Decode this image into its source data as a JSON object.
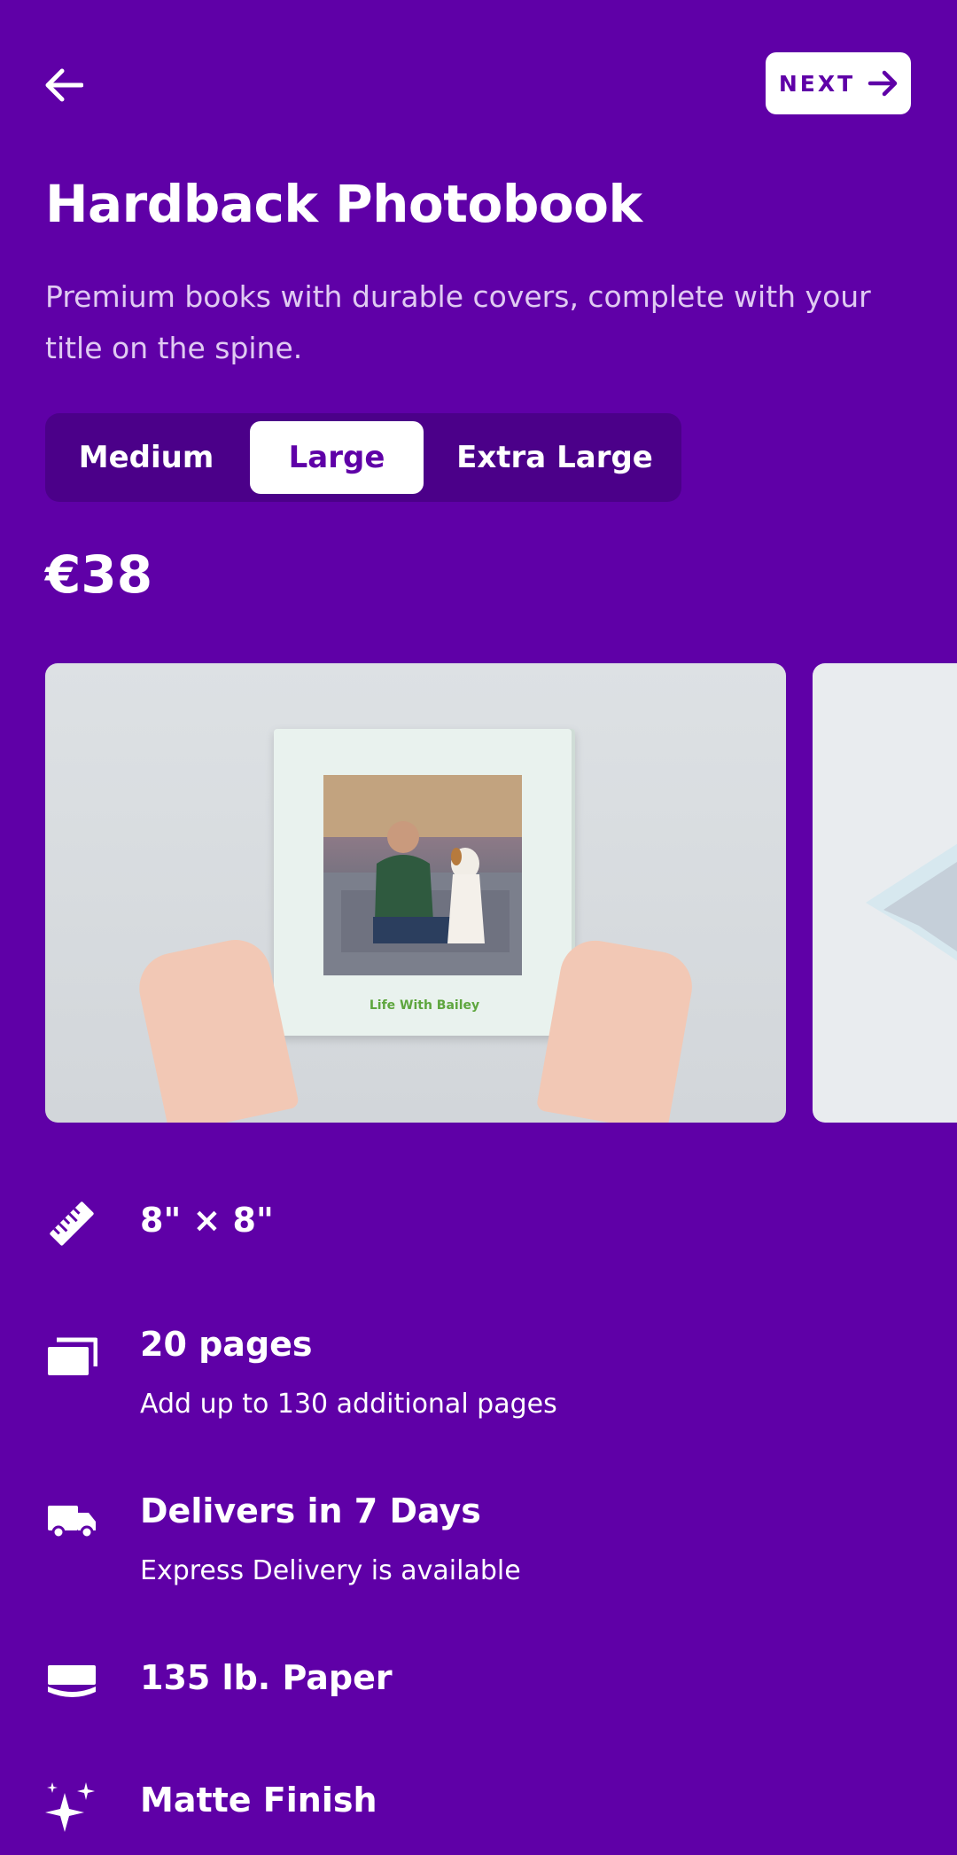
{
  "header": {
    "next_label": "NEXT"
  },
  "product": {
    "title": "Hardback Photobook",
    "description": "Premium books with durable covers, complete with your title on the spine.",
    "price": "€38"
  },
  "sizes": {
    "options": [
      "Medium",
      "Large",
      "Extra Large"
    ],
    "selected": "Large"
  },
  "carousel": {
    "book_caption": "Life With Bailey"
  },
  "features": [
    {
      "icon": "ruler-icon",
      "title": "8\" × 8\"",
      "subtitle": ""
    },
    {
      "icon": "pages-icon",
      "title": "20 pages",
      "subtitle": "Add up to 130 additional pages"
    },
    {
      "icon": "truck-icon",
      "title": "Delivers in 7 Days",
      "subtitle": "Express Delivery is available"
    },
    {
      "icon": "paper-icon",
      "title": "135 lb. Paper",
      "subtitle": ""
    },
    {
      "icon": "sparkle-icon",
      "title": "Matte Finish",
      "subtitle": ""
    }
  ],
  "colors": {
    "background": "#5f00a7",
    "switch_bg": "#4b0089",
    "accent_text": "#5f00a7"
  }
}
